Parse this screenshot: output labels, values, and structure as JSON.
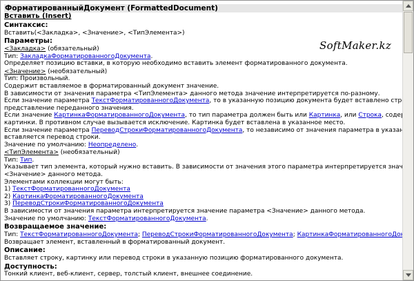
{
  "header": {
    "title": "ФорматированныйДокумент (FormattedDocument)",
    "method": "Вставить (Insert)"
  },
  "watermark": "SoftMaker.kz",
  "syntax": {
    "heading": "Синтаксис:",
    "text": "Вставить(<Закладка>, <Значение>, <ТипЭлемента>)"
  },
  "params": {
    "heading": "Параметры:",
    "bookmark": {
      "name": "<Закладка>",
      "req": " (обязательный)",
      "type_label": "Тип: ",
      "type_link": "ЗакладкаФорматированногоДокумента",
      "type_end": ".",
      "desc": "Определяет позицию вставки, в которую необходимо вставить элемент форматированного документа."
    },
    "value": {
      "name": "<Значение>",
      "req": " (необязательный)",
      "type_line": "Тип: Произвольный.",
      "l1": "Содержит вставляемое в форматированный документ значение.",
      "l2": "В зависимости от значения параметра <ТипЭлемента> данного метода значение интерпретируется по-разному.",
      "l3a": "Если значение параметра ",
      "l3link": "ТекстФорматированногоДокумента",
      "l3b": ", то в указанную позицию документа будет вставлено строковое",
      "l4": "представление переданного значения.",
      "l5a": "Если значение ",
      "l5link1": "КартинкаФорматированногоДокумента",
      "l5b": ", то тип параметра должен быть или ",
      "l5link2": "Картинка",
      "l5c": ", или ",
      "l5link3": "Строка",
      "l5d": ", содержащая URL",
      "l6": "картинки. В противном случае вызывается исключение. Картинка будет вставлена в указанное место.",
      "l7a": "Если значение параметра ",
      "l7link": "ПереводСтрокиФорматированногоДокумента",
      "l7b": ", то независимо от значения параметра в указанную позицию",
      "l8": "вставляется перевод строки.",
      "def_label": "Значение по умолчанию: ",
      "def_link": "Неопределено",
      "def_end": "."
    },
    "element_type": {
      "name": "<ТипЭлемента>",
      "req": " (необязательный)",
      "type_label": "Тип: ",
      "type_link": "Тип",
      "type_end": ".",
      "l1": "Указывает тип элемента, который нужно вставить. В зависимости от значения этого параметра интерпретируется значение параметра",
      "l2": "<Значение> данного метода.",
      "l3": "Элементами коллекции могут быть:",
      "items": [
        {
          "num": "1) ",
          "link": "ТекстФорматированногоДокумента"
        },
        {
          "num": "2) ",
          "link": "КартинкаФорматированногоДокумента"
        },
        {
          "num": "3) ",
          "link": "ПереводСтрокиФорматированногоДокумента"
        }
      ],
      "l4": "В зависимости от значения параметра интерпретируется значение параметра <Значение> данного метода.",
      "def_label": "Значение по умолчанию: ",
      "def_link": "ТекстФорматированногоДокумента",
      "def_end": "."
    }
  },
  "returns": {
    "heading": "Возвращаемое значение:",
    "type_label": "Тип: ",
    "link1": "ТекстФорматированногоДокумента",
    "sep1": "; ",
    "link2": "ПереводСтрокиФорматированногоДокумента",
    "sep2": "; ",
    "link3": "КартинкаФорматированногоДокумента",
    "end": ".",
    "desc": "Возвращает элемент, вставленный в форматированный документ."
  },
  "description": {
    "heading": "Описание:",
    "text": "Вставляет строку, картинку или перевод строки в указанную позицию форматированного документа."
  },
  "availability": {
    "heading": "Доступность:",
    "text": "Тонкий клиент, веб-клиент, сервер, толстый клиент, внешнее соединение."
  }
}
